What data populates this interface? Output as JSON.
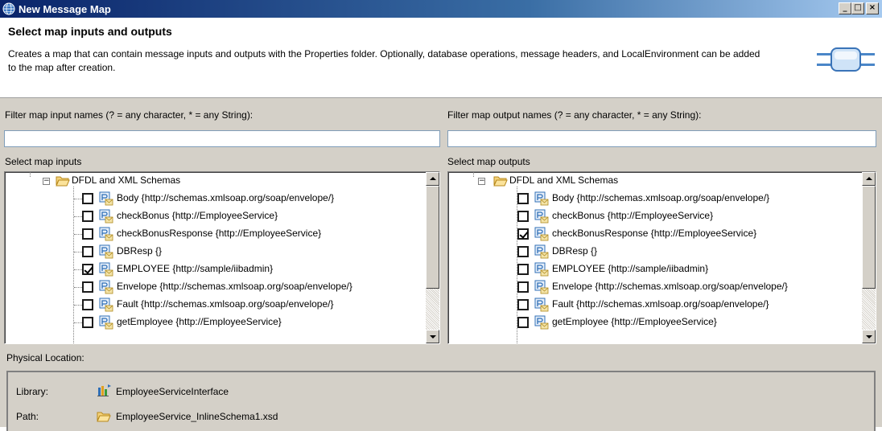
{
  "window": {
    "title": "New Message Map",
    "controls": [
      "_",
      "□",
      "×"
    ]
  },
  "header": {
    "title": "Select map inputs and outputs",
    "description": "Creates a map that can contain message inputs and outputs with the Properties folder. Optionally, database operations, message headers, and LocalEnvironment can be added to the map after creation."
  },
  "input_filter": {
    "label": "Filter map input names (? = any character, * = any String):",
    "value": ""
  },
  "output_filter": {
    "label": "Filter map output names (? = any character, * = any String):",
    "value": ""
  },
  "inputs": {
    "label": "Select map inputs",
    "folder": "DFDL and XML Schemas",
    "items": [
      {
        "label": "Body {http://schemas.xmlsoap.org/soap/envelope/}",
        "checked": false
      },
      {
        "label": "checkBonus {http://EmployeeService}",
        "checked": false
      },
      {
        "label": "checkBonusResponse {http://EmployeeService}",
        "checked": false
      },
      {
        "label": "DBResp {}",
        "checked": false
      },
      {
        "label": "EMPLOYEE {http://sample/iibadmin}",
        "checked": true
      },
      {
        "label": "Envelope {http://schemas.xmlsoap.org/soap/envelope/}",
        "checked": false
      },
      {
        "label": "Fault {http://schemas.xmlsoap.org/soap/envelope/}",
        "checked": false
      },
      {
        "label": "getEmployee {http://EmployeeService}",
        "checked": false
      }
    ]
  },
  "outputs": {
    "label": "Select map outputs",
    "folder": "DFDL and XML Schemas",
    "items": [
      {
        "label": "Body {http://schemas.xmlsoap.org/soap/envelope/}",
        "checked": false
      },
      {
        "label": "checkBonus {http://EmployeeService}",
        "checked": false
      },
      {
        "label": "checkBonusResponse {http://EmployeeService}",
        "checked": true
      },
      {
        "label": "DBResp {}",
        "checked": false
      },
      {
        "label": "EMPLOYEE {http://sample/iibadmin}",
        "checked": false
      },
      {
        "label": "Envelope {http://schemas.xmlsoap.org/soap/envelope/}",
        "checked": false
      },
      {
        "label": "Fault {http://schemas.xmlsoap.org/soap/envelope/}",
        "checked": false
      },
      {
        "label": "getEmployee {http://EmployeeService}",
        "checked": false
      }
    ]
  },
  "physical_location": {
    "label": "Physical Location:",
    "library_label": "Library:",
    "library_value": "EmployeeServiceInterface",
    "path_label": "Path:",
    "path_value": "EmployeeService_InlineSchema1.xsd"
  }
}
